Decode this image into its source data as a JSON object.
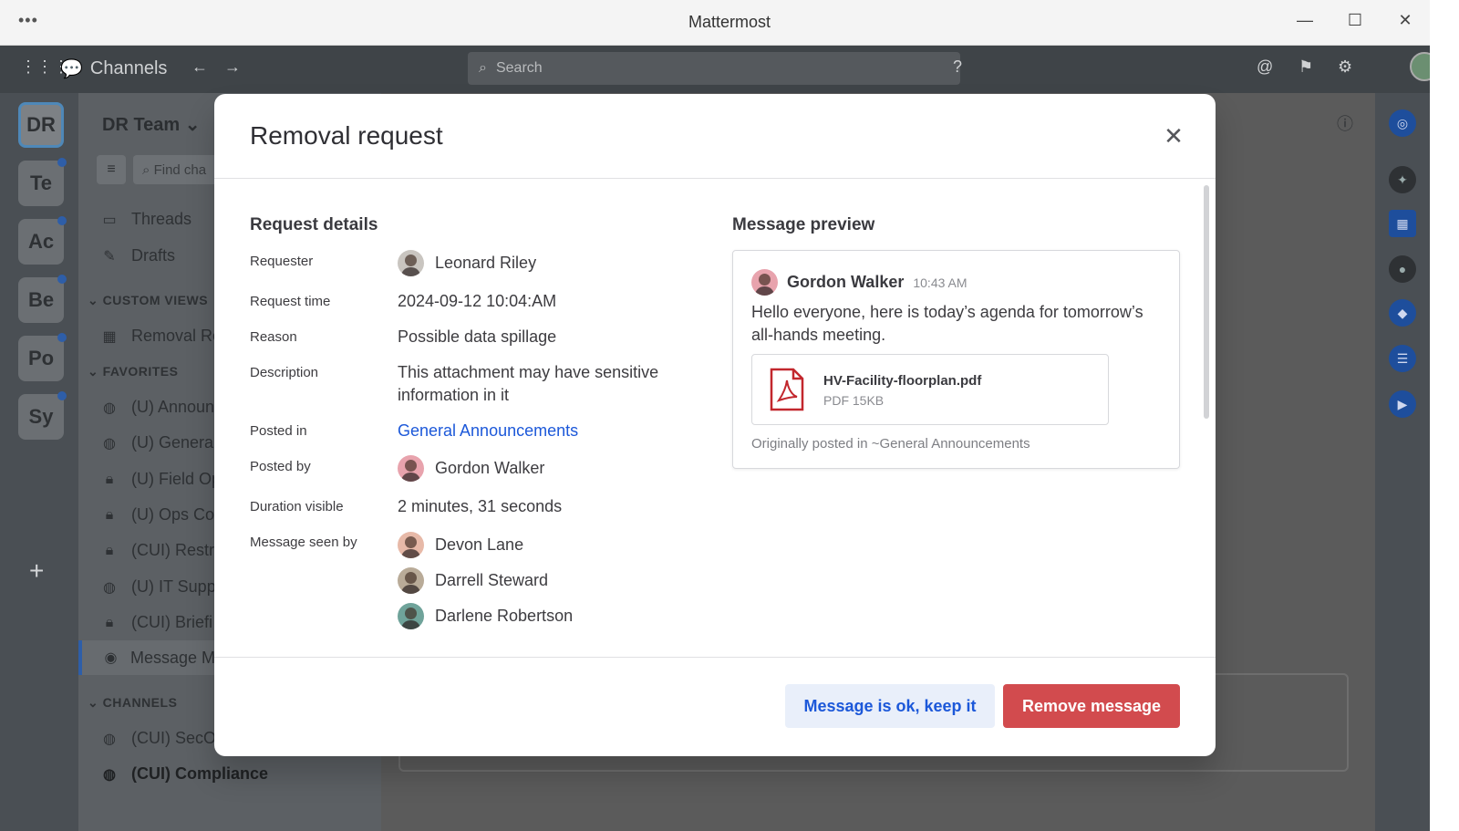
{
  "window": {
    "title": "Mattermost"
  },
  "header": {
    "product": "Channels",
    "search_placeholder": "Search"
  },
  "teams": [
    {
      "initials": "DR",
      "active": true,
      "unread": false
    },
    {
      "initials": "Te",
      "unread": true
    },
    {
      "initials": "Ac",
      "unread": true
    },
    {
      "initials": "Be",
      "unread": true
    },
    {
      "initials": "Po",
      "unread": true
    },
    {
      "initials": "Sy",
      "unread": true
    }
  ],
  "sidebar": {
    "team_name": "DR Team",
    "find_placeholder": "Find cha",
    "threads": "Threads",
    "drafts": "Drafts",
    "custom_views_header": "CUSTOM VIEWS",
    "custom_views": [
      "Removal Re"
    ],
    "favorites_header": "FAVORITES",
    "favorites": [
      {
        "label": "(U) Announ",
        "icon": "globe-icon"
      },
      {
        "label": "(U) Genera",
        "icon": "globe-icon"
      },
      {
        "label": "(U) Field Op",
        "icon": "lock-icon"
      },
      {
        "label": "(U) Ops Coo",
        "icon": "lock-icon"
      },
      {
        "label": "(CUI) Restri",
        "icon": "lock-icon"
      },
      {
        "label": "(U) IT Supp",
        "icon": "globe-icon"
      },
      {
        "label": "(CUI) Briefi",
        "icon": "lock-icon"
      },
      {
        "label": "Message M",
        "icon": "bot-icon"
      }
    ],
    "channels_header": "CHANNELS",
    "channels": [
      {
        "label": "(CUI) SecOp",
        "icon": "globe-icon"
      },
      {
        "label": "(CUI) Compliance",
        "icon": "globe-icon"
      }
    ]
  },
  "modal": {
    "title": "Removal request",
    "request_details_title": "Request details",
    "message_preview_title": "Message preview",
    "fields": {
      "requester_label": "Requester",
      "requester": "Leonard Riley",
      "request_time_label": "Request time",
      "request_time": "2024-09-12 10:04:AM",
      "reason_label": "Reason",
      "reason": "Possible data spillage",
      "description_label": "Description",
      "description": "This attachment may have sensitive information in it",
      "posted_in_label": "Posted in",
      "posted_in": "General Announcements",
      "posted_by_label": "Posted by",
      "posted_by": "Gordon Walker",
      "duration_label": "Duration visible",
      "duration": "2 minutes, 31 seconds",
      "seen_by_label": "Message seen by",
      "seen_by": [
        "Devon Lane",
        "Darrell Steward",
        "Darlene Robertson"
      ]
    },
    "preview": {
      "author": "Gordon Walker",
      "time": "10:43 AM",
      "message": "Hello everyone, here is today’s agenda for tomorrow’s all-hands meeting.",
      "file_name": "HV-Facility-floorplan.pdf",
      "file_meta": "PDF 15KB",
      "origin": "Originally posted in ~General Announcements"
    },
    "keep_button": "Message is ok, keep it",
    "remove_button": "Remove message"
  },
  "colors": {
    "accent": "#1c58d9",
    "danger": "#d24b4e",
    "unread_dot": "#2e5ea8"
  }
}
